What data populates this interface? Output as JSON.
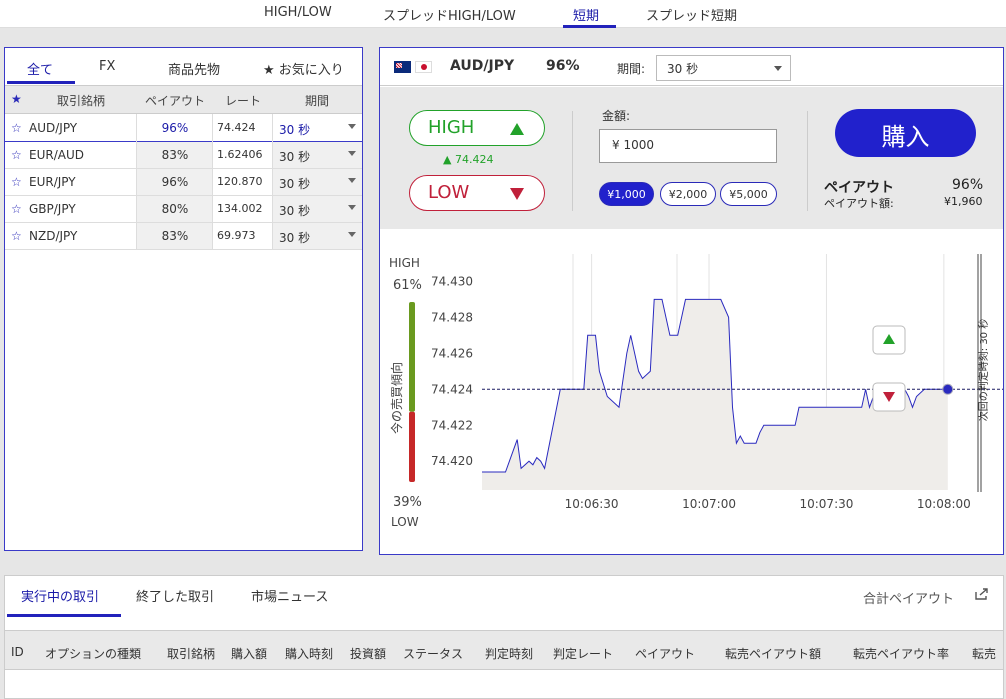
{
  "top_tabs": {
    "items": [
      "HIGH/LOW",
      "スプレッドHIGH/LOW",
      "短期",
      "スプレッド短期"
    ],
    "active": "短期"
  },
  "left_panel": {
    "tabs": [
      "全て",
      "FX",
      "商品先物",
      "★ お気に入り"
    ],
    "active_tab": "全て",
    "columns": {
      "star": "★",
      "symbol": "取引銘柄",
      "payout": "ペイアウト",
      "rate": "レート",
      "period": "期間"
    },
    "rows": [
      {
        "star": "☆",
        "symbol": "AUD/JPY",
        "payout": "96%",
        "rate": "74.424",
        "period": "30 秒",
        "selected": true
      },
      {
        "star": "☆",
        "symbol": "EUR/AUD",
        "payout": "83%",
        "rate": "1.62406",
        "period": "30 秒",
        "selected": false
      },
      {
        "star": "☆",
        "symbol": "EUR/JPY",
        "payout": "96%",
        "rate": "120.870",
        "period": "30 秒",
        "selected": false
      },
      {
        "star": "☆",
        "symbol": "GBP/JPY",
        "payout": "80%",
        "rate": "134.002",
        "period": "30 秒",
        "selected": false
      },
      {
        "star": "☆",
        "symbol": "NZD/JPY",
        "payout": "83%",
        "rate": "69.973",
        "period": "30 秒",
        "selected": false
      }
    ]
  },
  "trade_panel": {
    "symbol": "AUD/JPY",
    "payout": "96%",
    "period_label": "期間:",
    "period_value": "30 秒",
    "high_label": "HIGH",
    "high_rate": "▲ 74.424",
    "low_label": "LOW",
    "amount_label": "金額:",
    "amount_value": "¥ 1000",
    "chips": [
      "¥1,000",
      "¥2,000",
      "¥5,000"
    ],
    "active_chip": "¥1,000",
    "buy_label": "購入",
    "payout_label": "ペイアウト",
    "payout_value": "96%",
    "payout_amount_label": "ペイアウト額:",
    "payout_amount_value": "¥1,960"
  },
  "sentiment": {
    "high_label": "HIGH",
    "high_pct": "61%",
    "low_label": "LOW",
    "low_pct": "39%",
    "high_fraction": 0.61,
    "low_fraction": 0.39,
    "axis_label": "今の売買傾向",
    "high_color": "#6a9a1f",
    "low_color": "#c62828"
  },
  "chart_data": {
    "type": "line",
    "x_ticks": [
      "10:06:30",
      "10:07:00",
      "10:07:30",
      "10:08:00"
    ],
    "y_ticks": [
      "74.430",
      "74.428",
      "74.426",
      "74.424",
      "74.422",
      "74.420"
    ],
    "ylim": [
      74.4184,
      74.4313
    ],
    "x_seconds_range": [
      0,
      128
    ],
    "x_tick_seconds": [
      28,
      58,
      88,
      118
    ],
    "values": [
      [
        0,
        74.4194
      ],
      [
        6,
        74.4194
      ],
      [
        7,
        74.42
      ],
      [
        9,
        74.4212
      ],
      [
        10,
        74.4196
      ],
      [
        12,
        74.42
      ],
      [
        13,
        74.4198
      ],
      [
        14,
        74.4202
      ],
      [
        15,
        74.42
      ],
      [
        16,
        74.4196
      ],
      [
        20,
        74.424
      ],
      [
        26,
        74.424
      ],
      [
        27,
        74.427
      ],
      [
        29,
        74.427
      ],
      [
        30,
        74.425
      ],
      [
        32,
        74.4236
      ],
      [
        35,
        74.423
      ],
      [
        37,
        74.426
      ],
      [
        38,
        74.427
      ],
      [
        40,
        74.425
      ],
      [
        41,
        74.4246
      ],
      [
        43,
        74.425
      ],
      [
        44,
        74.429
      ],
      [
        46,
        74.429
      ],
      [
        48,
        74.427
      ],
      [
        50,
        74.427
      ],
      [
        52,
        74.429
      ],
      [
        61,
        74.429
      ],
      [
        63,
        74.428
      ],
      [
        64,
        74.423
      ],
      [
        65,
        74.421
      ],
      [
        66,
        74.4214
      ],
      [
        67,
        74.421
      ],
      [
        70,
        74.421
      ],
      [
        71,
        74.4216
      ],
      [
        72,
        74.422
      ],
      [
        80,
        74.422
      ],
      [
        81,
        74.423
      ],
      [
        97,
        74.423
      ],
      [
        98,
        74.424
      ],
      [
        99,
        74.423
      ],
      [
        100,
        74.4236
      ],
      [
        101,
        74.424
      ],
      [
        103,
        74.423
      ],
      [
        104,
        74.424
      ],
      [
        108,
        74.424
      ],
      [
        109,
        74.4236
      ],
      [
        110,
        74.423
      ],
      [
        111,
        74.4236
      ],
      [
        113,
        74.424
      ],
      [
        119,
        74.424
      ]
    ],
    "current_rate": 74.424,
    "line_color": "#2a2abf",
    "fill_color": "#efedea",
    "deadline_label": "次回の判定時刻: 30 秒"
  },
  "bottom_panel": {
    "tabs": [
      "実行中の取引",
      "終了した取引",
      "市場ニュース"
    ],
    "active_tab": "実行中の取引",
    "total_payout_label": "合計ペイアウト",
    "columns": [
      "ID",
      "オプションの種類",
      "取引銘柄",
      "購入額",
      "購入時刻",
      "投資額",
      "ステータス",
      "判定時刻",
      "判定レート",
      "ペイアウト",
      "転売ペイアウト額",
      "転売ペイアウト率",
      "転売"
    ]
  }
}
